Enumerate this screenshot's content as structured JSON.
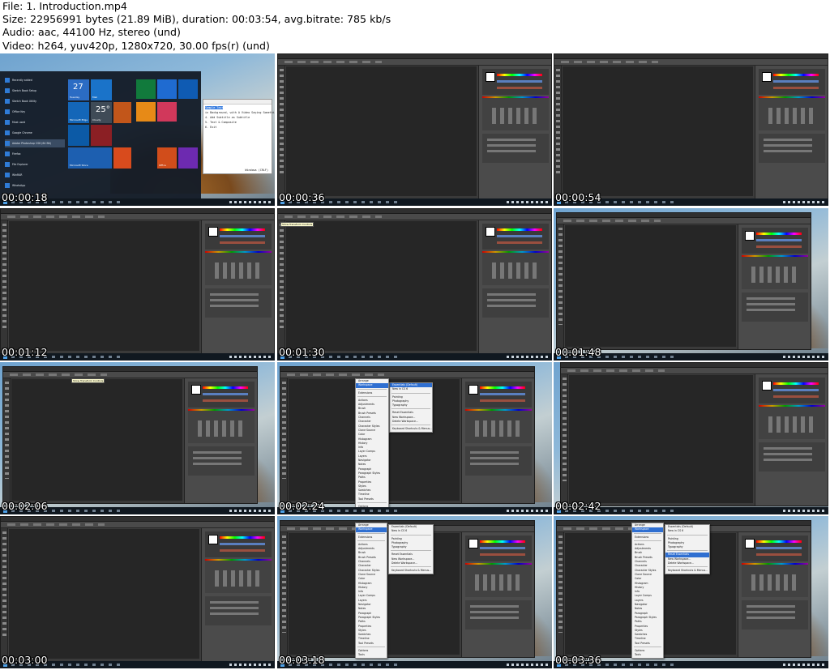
{
  "header": {
    "file": "File: 1. Introduction.mp4",
    "size": "Size: 22956991 bytes (21.89 MiB), duration: 00:03:54, avg.bitrate: 785 kb/s",
    "audio": "Audio: aac, 44100 Hz, stereo (und)",
    "video": "Video: h264, yuv420p, 1280x720, 30.00 fps(r) (und)"
  },
  "frames": [
    {
      "timestamp": "00:00:18",
      "scene": "start-menu"
    },
    {
      "timestamp": "00:00:36",
      "scene": "photoshop-full"
    },
    {
      "timestamp": "00:00:54",
      "scene": "photoshop-full"
    },
    {
      "timestamp": "00:01:12",
      "scene": "photoshop-full"
    },
    {
      "timestamp": "00:01:30",
      "scene": "photoshop-tooltip"
    },
    {
      "timestamp": "00:01:48",
      "scene": "photoshop-window"
    },
    {
      "timestamp": "00:02:06",
      "scene": "photoshop-window-tooltip"
    },
    {
      "timestamp": "00:02:24",
      "scene": "photoshop-window"
    },
    {
      "timestamp": "00:02:42",
      "scene": "photoshop-window-right"
    },
    {
      "timestamp": "00:03:00",
      "scene": "photoshop-full"
    },
    {
      "timestamp": "00:03:18",
      "scene": "photoshop-window-menu"
    },
    {
      "timestamp": "00:03:36",
      "scene": "photoshop-window-menu-hl"
    }
  ],
  "start_menu": {
    "apps": [
      "Recently added",
      "Sketch Book Setup",
      "Sketch Book Utility",
      "Office Key",
      "Most used",
      "Google Chrome",
      "Adobe Photoshop CS6 (64 Bit)",
      "Firefox",
      "File Explorer",
      "WinRAR",
      "WhatsApp"
    ],
    "tiles": {
      "day": "Tuesday",
      "date": "27",
      "mail": "Mail",
      "edge": "Microsoft Edge",
      "weather": "Cloudy",
      "temp": "25°",
      "store": "Microsoft Store",
      "office": "Office"
    }
  },
  "notepad": {
    "lines": [
      "Sample Text",
      "",
      "in Background, with A Video Saying Something.",
      "",
      "4. Add Subtitle as Subtitle",
      "5. Text & Composite",
      "6. Exit"
    ],
    "status": "Windows (CRLF)"
  },
  "workspace_menu": [
    "Essentials (Default)",
    "New in CS 6",
    "",
    "Painting",
    "Photography",
    "Typography",
    "",
    "Reset Essentials",
    "New Workspace...",
    "Delete Workspace...",
    "",
    "Keyboard Shortcuts & Menus..."
  ],
  "window_menu": [
    "Arrange",
    "Workspace",
    "",
    "Extensions",
    "",
    "Actions",
    "Adjustments",
    "Brush",
    "Brush Presets",
    "Channels",
    "Character",
    "Character Styles",
    "Clone Source",
    "Color",
    "Histogram",
    "History",
    "Info",
    "Layer Comps",
    "Layers",
    "Navigator",
    "Notes",
    "Paragraph",
    "Paragraph Styles",
    "Paths",
    "Properties",
    "Styles",
    "Swatches",
    "Timeline",
    "Tool Presets",
    "",
    "Options",
    "Tools"
  ],
  "tooltip": "Show Transform Controls"
}
